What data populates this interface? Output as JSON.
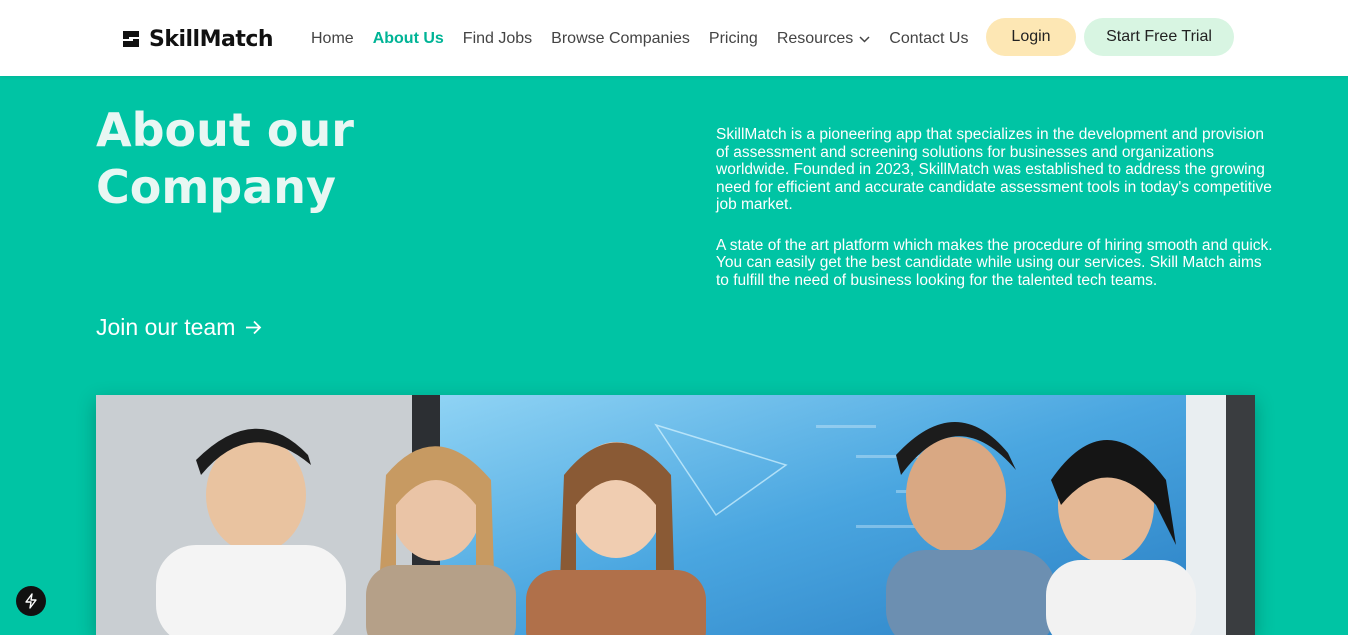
{
  "brand": {
    "name": "SkillMatch"
  },
  "nav": {
    "items": [
      {
        "label": "Home",
        "active": false
      },
      {
        "label": "About Us",
        "active": true
      },
      {
        "label": "Find Jobs",
        "active": false
      },
      {
        "label": "Browse Companies",
        "active": false
      },
      {
        "label": "Pricing",
        "active": false
      },
      {
        "label": "Resources",
        "active": false,
        "icon": "chevron-down-icon"
      },
      {
        "label": "Contact Us",
        "active": false
      }
    ],
    "login_label": "Login",
    "trial_label": "Start Free Trial"
  },
  "hero": {
    "title_line1": "About our",
    "title_line2": "Company",
    "paragraph1": "SkillMatch is a pioneering app that specializes in the development and provision of assessment and screening solutions for businesses and organizations worldwide. Founded in 2023, SkillMatch was established to address the growing need for efficient and accurate candidate assessment tools in today's competitive job market.",
    "paragraph2": "A state of the art platform which makes the procedure of hiring smooth and quick. You can easily get the best candidate while using our services. Skill Match aims to fulfill the need of business looking for the talented tech teams.",
    "join_label": "Join our team",
    "join_icon": "arrow-right-icon"
  },
  "colors": {
    "hero_bg": "#00c4a4",
    "accent": "#00b496",
    "login_bg": "#fde7b4",
    "trial_bg": "#d8f5e2"
  },
  "badge": {
    "icon": "lightning-icon"
  }
}
